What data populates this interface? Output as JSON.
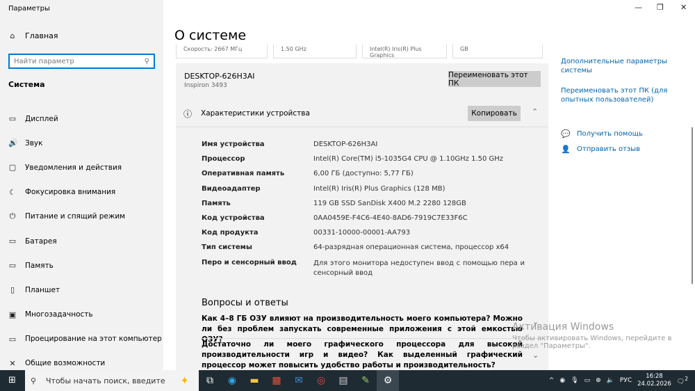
{
  "window": {
    "title": "Параметры"
  },
  "sidebar": {
    "home": "Главная",
    "search_placeholder": "Найти параметр",
    "section": "Система",
    "items": [
      {
        "label": "Дисплей",
        "icon": "▭"
      },
      {
        "label": "Звук",
        "icon": "🔊"
      },
      {
        "label": "Уведомления и действия",
        "icon": "▢"
      },
      {
        "label": "Фокусировка внимания",
        "icon": "☾"
      },
      {
        "label": "Питание и спящий режим",
        "icon": "⏻"
      },
      {
        "label": "Батарея",
        "icon": "▭"
      },
      {
        "label": "Память",
        "icon": "▭"
      },
      {
        "label": "Планшет",
        "icon": "▯"
      },
      {
        "label": "Многозадачность",
        "icon": "▣"
      },
      {
        "label": "Проецирование на этот компьютер",
        "icon": "▭"
      },
      {
        "label": "Общие возможности",
        "icon": "✕"
      }
    ]
  },
  "main": {
    "title": "О системе",
    "tiles": [
      "Скорость: 2667 МГц",
      "1.50 GHz",
      "Intel(R) Iris(R) Plus Graphics",
      "GB"
    ],
    "pc_name": "DESKTOP-626H3AI",
    "pc_model": "Inspiron 3493",
    "rename_button": "Переименовать этот ПК",
    "specs_title": "Характеристики устройства",
    "copy_button": "Копировать",
    "specs": [
      {
        "k": "Имя устройства",
        "v": "DESKTOP-626H3AI"
      },
      {
        "k": "Процессор",
        "v": "Intel(R) Core(TM) i5-1035G4 CPU @ 1.10GHz   1.50 GHz"
      },
      {
        "k": "Оперативная память",
        "v": "6,00 ГБ (доступно: 5,77 ГБ)"
      },
      {
        "k": "Видеоадаптер",
        "v": "Intel(R) Iris(R) Plus Graphics (128 MB)"
      },
      {
        "k": "Память",
        "v": "119 GB SSD SanDisk X400 M.2 2280 128GB"
      },
      {
        "k": "Код устройства",
        "v": "0AA0459E-F4C6-4E40-8AD6-7919C7E33F6C"
      },
      {
        "k": "Код продукта",
        "v": "00331-10000-00001-AA793"
      },
      {
        "k": "Тип системы",
        "v": "64-разрядная операционная система, процессор x64"
      },
      {
        "k": "Перо и сенсорный ввод",
        "v": "Для этого монитора недоступен ввод с помощью пера и сенсорный ввод"
      }
    ],
    "qa_title": "Вопросы и ответы",
    "qa": [
      "Как 4–8 ГБ ОЗУ влияют на производительность моего компьютера? Можно ли без проблем запускать современные приложения с этой емкостью ОЗУ?",
      "Достаточно ли моего графического процессора для высокой производительности игр и видео? Как выделенный графический процессор может повысить удобство работы и производительность?"
    ]
  },
  "right": {
    "links": [
      "Дополнительные параметры системы",
      "Переименовать этот ПК (для опытных пользователей)",
      "Получить помощь",
      "Отправить отзыв"
    ]
  },
  "watermark": {
    "title": "Активация Windows",
    "text": "Чтобы активировать Windows, перейдите в раздел \"Параметры\"."
  },
  "taskbar": {
    "search": "Чтобы начать поиск, введите",
    "lang": "РУС",
    "time": "16:28",
    "date": "24.02.2026",
    "notif": "2"
  }
}
